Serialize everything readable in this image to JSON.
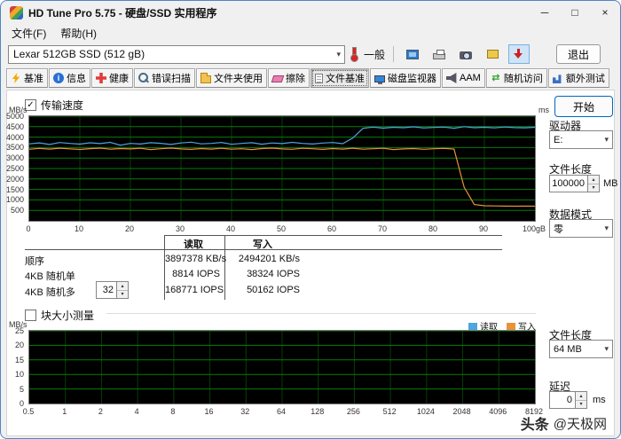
{
  "window": {
    "title": "HD Tune Pro 5.75 - 硬盘/SSD 实用程序"
  },
  "icons": {
    "minimize": "─",
    "maximize": "□",
    "close": "×",
    "dropdown": "▾",
    "spin_up": "▴",
    "spin_down": "▾",
    "check": "✓",
    "swap_arrows": "⇄"
  },
  "menu": {
    "file": "文件(F)",
    "help": "帮助(H)"
  },
  "toolbar": {
    "drive_combo": "Lexar 512GB SSD (512 gB)",
    "temperature_status": "一般",
    "exit": "退出"
  },
  "tabs": [
    {
      "label": "基准"
    },
    {
      "label": "信息"
    },
    {
      "label": "健康"
    },
    {
      "label": "错误扫描"
    },
    {
      "label": "文件夹使用"
    },
    {
      "label": "擦除"
    },
    {
      "label": "文件基准",
      "active": true
    },
    {
      "label": "磁盘监视器"
    },
    {
      "label": "AAM"
    },
    {
      "label": "随机访问"
    },
    {
      "label": "额外测试"
    }
  ],
  "benchmark": {
    "section_label": "传输速度",
    "start": "开始",
    "drive": {
      "label": "驱动器",
      "value": "E:"
    },
    "file_length": {
      "label": "文件长度",
      "value": "100000",
      "unit": "MB"
    },
    "data_mode": {
      "label": "数据模式",
      "value": "零"
    },
    "results": {
      "read_header": "读取",
      "write_header": "写入",
      "rows": [
        {
          "label": "顺序",
          "read": "3897378 KB/s",
          "write": "2494201 KB/s"
        },
        {
          "label": "4KB 随机单",
          "read": "8814 IOPS",
          "write": "38324 IOPS"
        },
        {
          "label": "4KB 随机多",
          "queue_depth": "32",
          "read": "168771 IOPS",
          "write": "50162 IOPS"
        }
      ]
    }
  },
  "block_test": {
    "section_label": "块大小测量",
    "file_length": {
      "label": "文件长度",
      "value": "64 MB"
    },
    "latency": {
      "label": "延迟",
      "value": "0",
      "unit": "ms"
    }
  },
  "watermark": {
    "brand": "头条",
    "account": "@天极网"
  },
  "chart_data": [
    {
      "type": "line",
      "title": "传输速度",
      "ylabel": "MB/s",
      "ylabel_right": "ms",
      "xlabel": "",
      "xlim": [
        0,
        100
      ],
      "ylim": [
        0,
        5000
      ],
      "yticks": [
        500,
        1000,
        1500,
        2000,
        2500,
        3000,
        3500,
        4000,
        4500,
        5000
      ],
      "xticks": [
        "0",
        "10",
        "20",
        "30",
        "40",
        "50",
        "60",
        "70",
        "80",
        "90",
        "100gB"
      ],
      "grid": true,
      "background": "#000000",
      "grid_color": "#077d07",
      "grid_minor": "#063d06",
      "x": [
        0,
        2,
        4,
        6,
        8,
        10,
        12,
        14,
        16,
        18,
        20,
        22,
        24,
        26,
        28,
        30,
        32,
        34,
        36,
        38,
        40,
        42,
        44,
        46,
        48,
        50,
        52,
        54,
        56,
        58,
        60,
        62,
        64,
        66,
        68,
        70,
        72,
        74,
        76,
        78,
        80,
        82,
        84,
        86,
        88,
        90,
        92,
        94,
        96,
        98,
        100
      ],
      "series": [
        {
          "name": "读取",
          "color": "#4da6e0",
          "y": [
            3680,
            3725,
            3650,
            3740,
            3700,
            3665,
            3730,
            3690,
            3750,
            3615,
            3700,
            3670,
            3735,
            3705,
            3650,
            3720,
            3760,
            3680,
            3700,
            3745,
            3655,
            3700,
            3735,
            3660,
            3720,
            3690,
            3750,
            3700,
            3670,
            3715,
            3740,
            3685,
            3960,
            4420,
            4480,
            4430,
            4470,
            4450,
            4490,
            4435,
            4460,
            4480,
            4425,
            4500,
            4450,
            4470,
            4440,
            4485,
            4455,
            4445,
            4470
          ]
        },
        {
          "name": "写入",
          "color": "#e8923c",
          "y": [
            3420,
            3460,
            3430,
            3470,
            3440,
            3410,
            3450,
            3475,
            3425,
            3455,
            3435,
            3465,
            3405,
            3445,
            3475,
            3435,
            3415,
            3455,
            3430,
            3465,
            3425,
            3445,
            3405,
            3455,
            3475,
            3435,
            3420,
            3465,
            3445,
            3415,
            3455,
            3430,
            3470,
            3425,
            3445,
            3465,
            3405,
            3435,
            3455,
            3420,
            3445,
            3460,
            3430,
            1600,
            780,
            720,
            710,
            705,
            700,
            705,
            700
          ]
        }
      ]
    },
    {
      "type": "line",
      "title": "块大小测量",
      "ylabel": "MB/s",
      "xlabel": "",
      "ylim": [
        0,
        25
      ],
      "yticks": [
        0,
        5,
        10,
        15,
        20,
        25
      ],
      "xticks": [
        "0.5",
        "1",
        "2",
        "4",
        "8",
        "16",
        "32",
        "64",
        "128",
        "256",
        "512",
        "1024",
        "2048",
        "4096",
        "8192"
      ],
      "grid": true,
      "background": "#000000",
      "grid_color": "#077d07",
      "grid_minor": "#063d06",
      "series": [
        {
          "name": "读取",
          "color": "#4da6e0",
          "y": []
        },
        {
          "name": "写入",
          "color": "#e8923c",
          "y": []
        }
      ]
    }
  ]
}
